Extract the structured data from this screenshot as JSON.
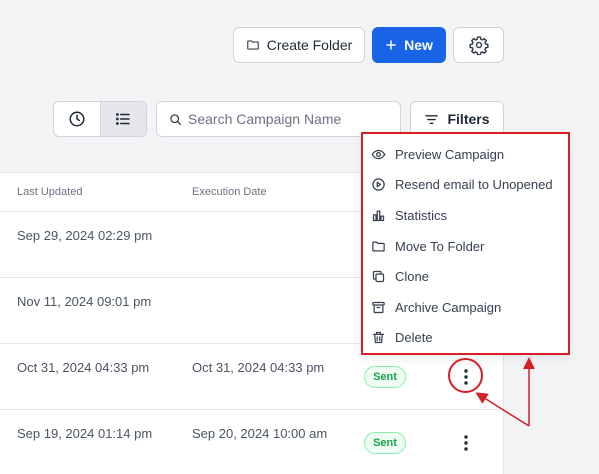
{
  "toolbar": {
    "create_folder_label": "Create Folder",
    "new_label": "New"
  },
  "search": {
    "placeholder": "Search Campaign Name"
  },
  "filters": {
    "label": "Filters"
  },
  "table": {
    "headers": {
      "last_updated": "Last Updated",
      "execution_date": "Execution Date"
    },
    "rows": [
      {
        "last_updated": "Sep 29, 2024 02:29 pm",
        "execution_date": "",
        "status": ""
      },
      {
        "last_updated": "Nov 11, 2024 09:01 pm",
        "execution_date": "",
        "status": ""
      },
      {
        "last_updated": "Oct 31, 2024 04:33 pm",
        "execution_date": "Oct 31, 2024 04:33 pm",
        "status": "Sent"
      },
      {
        "last_updated": "Sep 19, 2024 01:14 pm",
        "execution_date": "Sep 20, 2024 10:00 am",
        "status": "Sent"
      }
    ]
  },
  "menu": {
    "items": [
      {
        "label": "Preview Campaign",
        "icon": "eye-icon"
      },
      {
        "label": "Resend email to Unopened",
        "icon": "play-circle-icon"
      },
      {
        "label": "Statistics",
        "icon": "bar-chart-icon"
      },
      {
        "label": "Move To Folder",
        "icon": "folder-icon"
      },
      {
        "label": "Clone",
        "icon": "copy-icon"
      },
      {
        "label": "Archive Campaign",
        "icon": "archive-icon"
      },
      {
        "label": "Delete",
        "icon": "trash-icon"
      }
    ]
  },
  "colors": {
    "primary": "#1963e6",
    "annotation": "#d61f26",
    "sent_badge": "#16a34a"
  }
}
